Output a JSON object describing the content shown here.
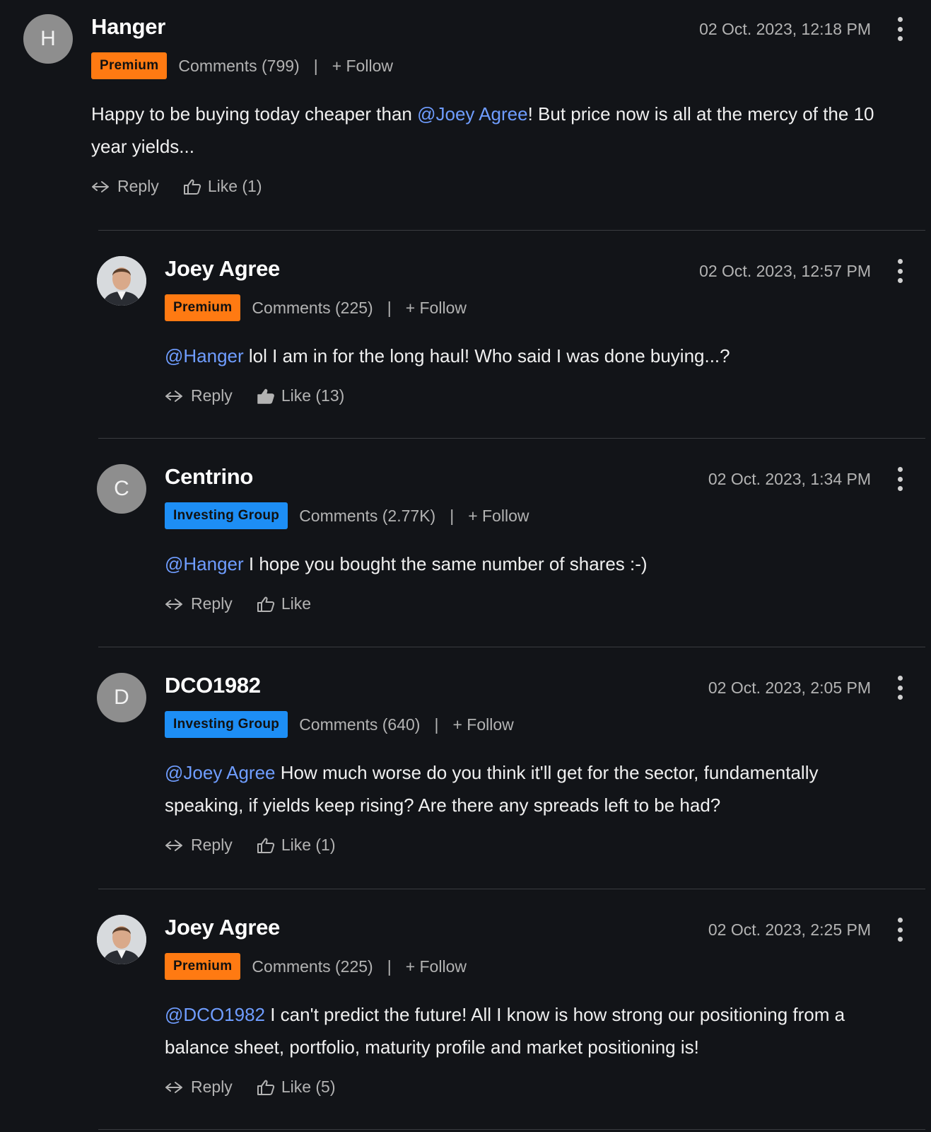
{
  "comments": [
    {
      "avatar_letter": "H",
      "author": "Hanger",
      "badge": "Premium",
      "comments_count": "Comments (799)",
      "separator": "|",
      "follow": "+ Follow",
      "date": "02 Oct. 2023, 12:18 PM",
      "mention": "",
      "text_before": "Happy to be buying today cheaper than ",
      "text_mention": "@Joey Agree",
      "text_after": "! But price now is all at the mercy of the 10 year yields...",
      "reply": "Reply",
      "like": "Like (1)"
    },
    {
      "author": "Joey Agree",
      "badge": "Premium",
      "comments_count": "Comments (225)",
      "separator": "|",
      "follow": "+ Follow",
      "date": "02 Oct. 2023, 12:57 PM",
      "mention": "@Hanger",
      "text": " lol I am in for the long haul! Who said I was done buying...?",
      "reply": "Reply",
      "like": "Like (13)"
    },
    {
      "avatar_letter": "C",
      "author": "Centrino",
      "badge": "Investing Group",
      "comments_count": "Comments (2.77K)",
      "separator": "|",
      "follow": "+ Follow",
      "date": "02 Oct. 2023, 1:34 PM",
      "mention": "@Hanger",
      "text": " I hope you bought the same number of shares :-)",
      "reply": "Reply",
      "like": "Like"
    },
    {
      "avatar_letter": "D",
      "author": "DCO1982",
      "badge": "Investing Group",
      "comments_count": "Comments (640)",
      "separator": "|",
      "follow": "+ Follow",
      "date": "02 Oct. 2023, 2:05 PM",
      "mention": "@Joey Agree",
      "text": " How much worse do you think it'll get for the sector, fundamentally speaking, if yields keep rising? Are there any spreads left to be had?",
      "reply": "Reply",
      "like": "Like (1)"
    },
    {
      "author": "Joey Agree",
      "badge": "Premium",
      "comments_count": "Comments (225)",
      "separator": "|",
      "follow": "+ Follow",
      "date": "02 Oct. 2023, 2:25 PM",
      "mention": "@DCO1982",
      "text": " I can't predict the future! All I know is how strong our positioning from a balance sheet, portfolio, maturity profile and market positioning is!",
      "reply": "Reply",
      "like": "Like (5)"
    }
  ],
  "colors": {
    "background": "#121418",
    "premium_badge": "#ff7a12",
    "investing_group_badge": "#1d8ef5",
    "mention": "#6f9dff"
  },
  "icons": {
    "reply": "reply-arrow-icon",
    "like": "thumbs-up-icon",
    "like_filled": "thumbs-up-filled-icon",
    "more": "kebab-menu-icon"
  }
}
